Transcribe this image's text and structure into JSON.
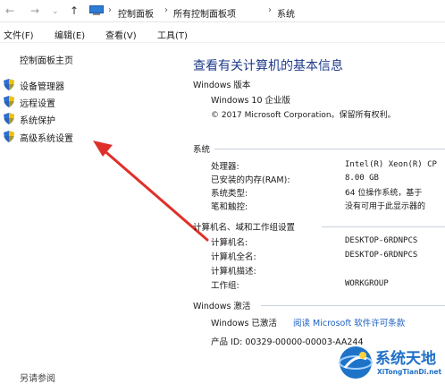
{
  "address_bar": {
    "crumbs": [
      "控制面板",
      "所有控制面板项",
      "系统"
    ]
  },
  "menu": {
    "items": [
      "文件(F)",
      "编辑(E)",
      "查看(V)",
      "工具(T)"
    ]
  },
  "sidebar": {
    "home": "控制面板主页",
    "links": [
      "设备管理器",
      "远程设置",
      "系统保护",
      "高级系统设置"
    ],
    "see_also": "另请参阅"
  },
  "main": {
    "title": "查看有关计算机的基本信息",
    "edition_header": "Windows 版本",
    "edition": "Windows 10 企业版",
    "copyright": "© 2017 Microsoft Corporation。保留所有权利。",
    "system_header": "系统",
    "system_rows": [
      {
        "label": "处理器:",
        "value": "Intel(R) Xeon(R) CP"
      },
      {
        "label": "已安装的内存(RAM):",
        "value": "8.00 GB"
      },
      {
        "label": "系统类型:",
        "value": "64 位操作系统，基于"
      },
      {
        "label": "笔和触控:",
        "value": "没有可用于此显示器的"
      }
    ],
    "computer_header": "计算机名、域和工作组设置",
    "computer_rows": [
      {
        "label": "计算机名:",
        "value": "DESKTOP-6RDNPCS"
      },
      {
        "label": "计算机全名:",
        "value": "DESKTOP-6RDNPCS"
      },
      {
        "label": "计算机描述:",
        "value": ""
      },
      {
        "label": "工作组:",
        "value": "WORKGROUP"
      }
    ],
    "activation_header": "Windows 激活",
    "activation_status": "Windows 已激活",
    "activation_link": "阅读 Microsoft 软件许可条款",
    "product_id": "产品 ID: 00329-00000-00003-AA244"
  },
  "watermark": {
    "title": "系统天地",
    "url": "XiTongTianDi.net"
  },
  "colors": {
    "title_blue": "#1e3a8a",
    "link_blue": "#1f5fbf",
    "annotation_red": "#e0302a"
  },
  "icons": [
    "back-arrow-icon",
    "forward-arrow-icon",
    "up-arrow-icon",
    "control-panel-icon",
    "shield-icon"
  ]
}
